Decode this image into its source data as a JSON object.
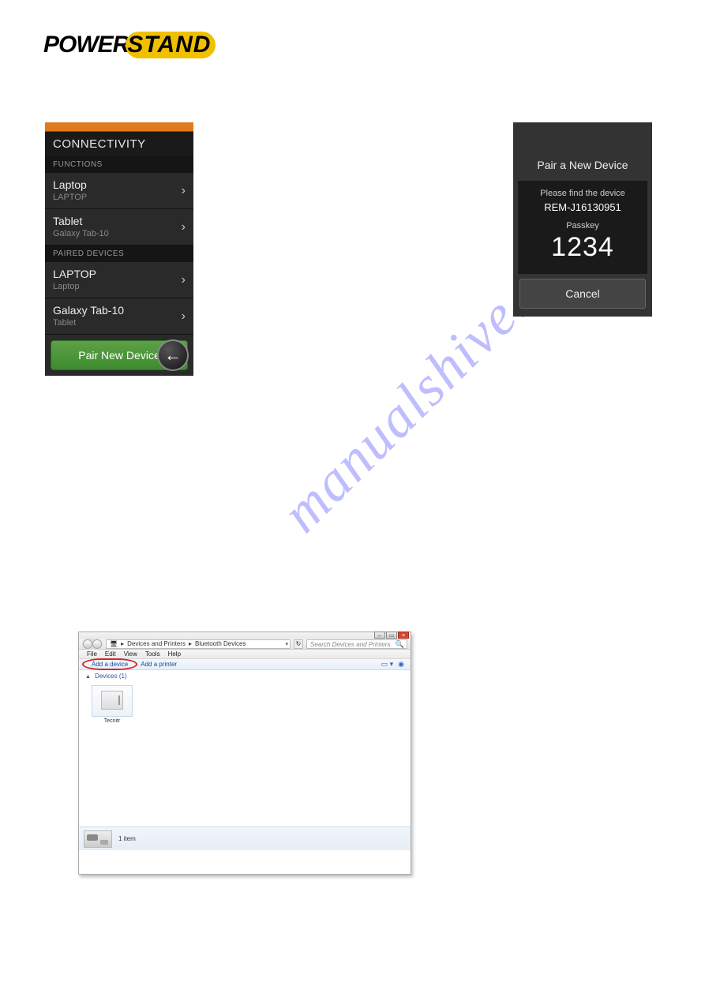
{
  "logo": {
    "left": "POWER",
    "right": "STAND"
  },
  "watermark": "manualshive.com",
  "phone1": {
    "title": "CONNECTIVITY",
    "functions_label": "FUNCTIONS",
    "functions": [
      {
        "name": "Laptop",
        "sub": "LAPTOP"
      },
      {
        "name": "Tablet",
        "sub": "Galaxy Tab-10"
      }
    ],
    "paired_label": "PAIRED DEVICES",
    "paired": [
      {
        "name": "LAPTOP",
        "sub": "Laptop"
      },
      {
        "name": "Galaxy Tab-10",
        "sub": "Tablet"
      }
    ],
    "pair_button": "Pair New Device"
  },
  "phone2": {
    "title": "Pair a New Device",
    "find_label": "Please find the device",
    "device_id": "REM-J16130951",
    "passkey_label": "Passkey",
    "passkey": "1234",
    "cancel": "Cancel"
  },
  "win": {
    "breadcrumb": {
      "a": "Devices and Printers",
      "b": "Bluetooth Devices"
    },
    "search_placeholder": "Search Devices and Printers",
    "menu": {
      "file": "File",
      "edit": "Edit",
      "view": "View",
      "tools": "Tools",
      "help": "Help"
    },
    "toolbar": {
      "add_device": "Add a device",
      "add_printer": "Add a printer"
    },
    "section": {
      "label": "Devices",
      "count": "(1)"
    },
    "device_name": "Tecnitr",
    "status_count": "1 item"
  }
}
